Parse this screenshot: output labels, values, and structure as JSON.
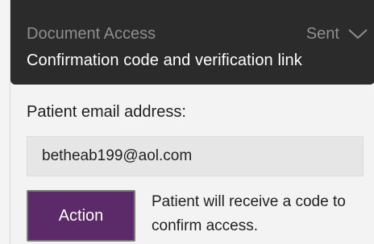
{
  "header": {
    "title": "Document Access",
    "status": "Sent",
    "subtitle": "Confirmation code and verification link"
  },
  "form": {
    "email_label": "Patient email address:",
    "email_value": "betheab199@aol.com"
  },
  "action": {
    "button_label": "Action",
    "description": "Patient will receive a code to confirm access."
  }
}
